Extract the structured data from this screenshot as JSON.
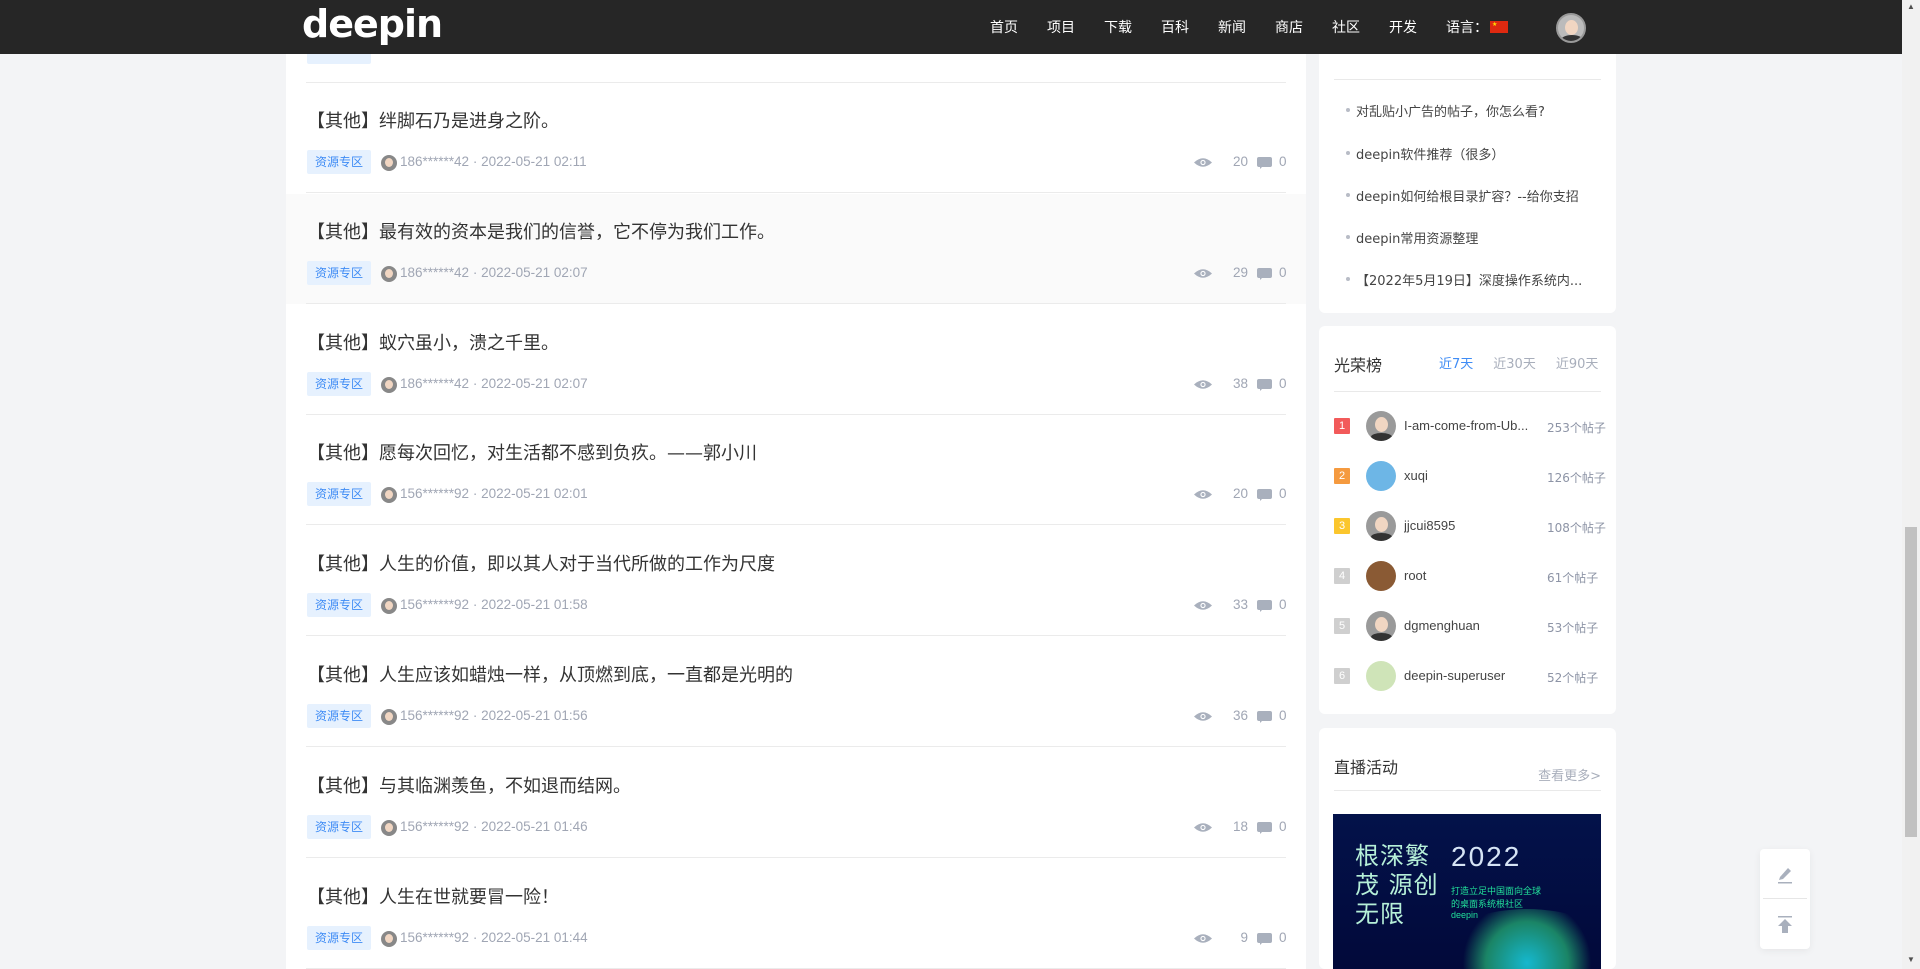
{
  "header": {
    "logo": "deepin",
    "nav": [
      "首页",
      "项目",
      "下载",
      "百科",
      "新闻",
      "商店",
      "社区",
      "开发"
    ],
    "language_label": "语言：",
    "flag": "china-flag"
  },
  "posts": [
    {
      "title": "【其他】绊脚石乃是进身之阶。",
      "tag": "资源专区",
      "author": "186******42",
      "time": "2022-05-21 02:11",
      "views": "20",
      "comments": "0"
    },
    {
      "title": "【其他】最有效的资本是我们的信誉，它不停为我们工作。",
      "tag": "资源专区",
      "author": "186******42",
      "time": "2022-05-21 02:07",
      "views": "29",
      "comments": "0"
    },
    {
      "title": "【其他】蚁穴虽小，溃之千里。",
      "tag": "资源专区",
      "author": "186******42",
      "time": "2022-05-21 02:07",
      "views": "38",
      "comments": "0"
    },
    {
      "title": "【其他】愿每次回忆，对生活都不感到负疚。——郭小川",
      "tag": "资源专区",
      "author": "156******92",
      "time": "2022-05-21 02:01",
      "views": "20",
      "comments": "0"
    },
    {
      "title": "【其他】人生的价值，即以其人对于当代所做的工作为尺度",
      "tag": "资源专区",
      "author": "156******92",
      "time": "2022-05-21 01:58",
      "views": "33",
      "comments": "0"
    },
    {
      "title": "【其他】人生应该如蜡烛一样，从顶燃到底，一直都是光明的",
      "tag": "资源专区",
      "author": "156******92",
      "time": "2022-05-21 01:56",
      "views": "36",
      "comments": "0"
    },
    {
      "title": "【其他】与其临渊羡鱼，不如退而结网。",
      "tag": "资源专区",
      "author": "156******92",
      "time": "2022-05-21 01:46",
      "views": "18",
      "comments": "0"
    },
    {
      "title": "【其他】人生在世就要冒一险！",
      "tag": "资源专区",
      "author": "156******92",
      "time": "2022-05-21 01:44",
      "views": "9",
      "comments": "0"
    }
  ],
  "recommend": {
    "items": [
      "对乱贴小广告的帖子，你怎么看?",
      "deepin软件推荐（很多）",
      "deepin如何给根目录扩容？--给你支招",
      "deepin常用资源整理",
      "【2022年5月19日】深度操作系统内..."
    ]
  },
  "ranking": {
    "title": "光荣榜",
    "tabs": [
      "近7天",
      "近30天",
      "近90天"
    ],
    "users": [
      {
        "rank": "1",
        "name": "I-am-come-from-Ub...",
        "count": "253个帖子",
        "color": "#f25a5a"
      },
      {
        "rank": "2",
        "name": "xuqi",
        "count": "126个帖子",
        "color": "#f59a3f"
      },
      {
        "rank": "3",
        "name": "jjcui8595",
        "count": "108个帖子",
        "color": "#fbc62d"
      },
      {
        "rank": "4",
        "name": "root",
        "count": "61个帖子",
        "color": "#cfcfcf"
      },
      {
        "rank": "5",
        "name": "dgmenghuan",
        "count": "53个帖子",
        "color": "#cfcfcf"
      },
      {
        "rank": "6",
        "name": "deepin-superuser",
        "count": "52个帖子",
        "color": "#cfcfcf"
      }
    ]
  },
  "live": {
    "title": "直播活动",
    "more": "查看更多>",
    "banner_text": "根深繁茂 源创无限",
    "banner_year": "2022",
    "banner_sub": "打造立足中国面向全球的桌面系统根社区 deepin"
  }
}
